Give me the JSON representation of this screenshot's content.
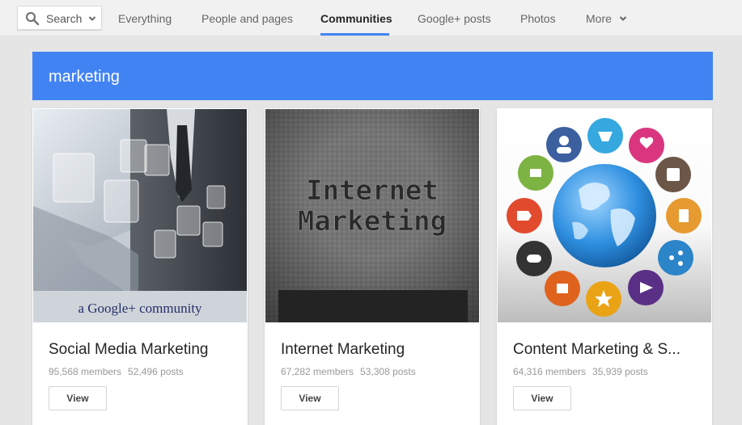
{
  "nav": {
    "search_label": "Search",
    "tabs": [
      {
        "label": "Everything"
      },
      {
        "label": "People and pages"
      },
      {
        "label": "Communities"
      },
      {
        "label": "Google+ posts"
      },
      {
        "label": "Photos"
      },
      {
        "label": "More"
      }
    ],
    "active_tab": "Communities"
  },
  "query": {
    "text": "marketing"
  },
  "cards": [
    {
      "title": "Social Media Marketing",
      "members": "95,568 members",
      "posts": "52,496 posts",
      "view_label": "View",
      "image_caption": "a Google+ community"
    },
    {
      "title": "Internet Marketing",
      "members": "67,282 members",
      "posts": "53,308 posts",
      "view_label": "View",
      "image_text_line1": "Internet",
      "image_text_line2": "Marketing"
    },
    {
      "title": "Content Marketing & S...",
      "members": "64,316 members",
      "posts": "35,939 posts",
      "view_label": "View"
    }
  ],
  "colors": {
    "accent": "#4285f4",
    "banner": "#4283f4",
    "background": "#e5e5e5"
  }
}
